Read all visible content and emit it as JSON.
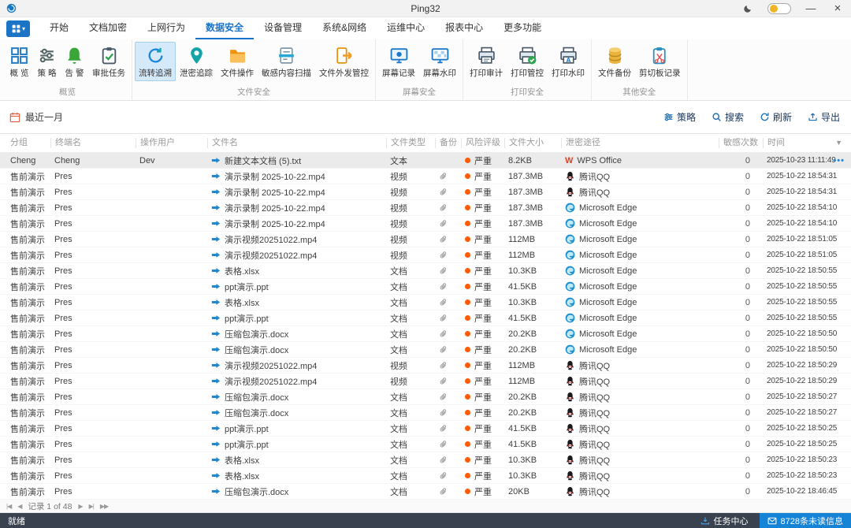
{
  "window": {
    "title": "Ping32"
  },
  "titlebar": {
    "minimize": "—",
    "close": "×"
  },
  "menu": {
    "tabs": [
      {
        "label": "开始"
      },
      {
        "label": "文档加密"
      },
      {
        "label": "上网行为"
      },
      {
        "label": "数据安全",
        "active": true
      },
      {
        "label": "设备管理"
      },
      {
        "label": "系统&网络"
      },
      {
        "label": "运维中心"
      },
      {
        "label": "报表中心"
      },
      {
        "label": "更多功能"
      }
    ]
  },
  "ribbon": {
    "groups": [
      {
        "label": "概览",
        "items": [
          {
            "label": "概 览",
            "icon": "grid"
          },
          {
            "label": "策 略",
            "icon": "sliders"
          },
          {
            "label": "告 警",
            "icon": "bell"
          },
          {
            "label": "审批任务",
            "icon": "clipboard-check"
          }
        ]
      },
      {
        "label": "文件安全",
        "items": [
          {
            "label": "流转追溯",
            "icon": "cycle",
            "selected": true
          },
          {
            "label": "泄密追踪",
            "icon": "pin"
          },
          {
            "label": "文件操作",
            "icon": "folder"
          },
          {
            "label": "敏感内容扫描",
            "icon": "doc-scan"
          },
          {
            "label": "文件外发管控",
            "icon": "doc-export"
          }
        ]
      },
      {
        "label": "屏幕安全",
        "items": [
          {
            "label": "屏幕记录",
            "icon": "monitor-record"
          },
          {
            "label": "屏幕水印",
            "icon": "monitor-watermark"
          }
        ]
      },
      {
        "label": "打印安全",
        "items": [
          {
            "label": "打印审计",
            "icon": "printer"
          },
          {
            "label": "打印管控",
            "icon": "printer-check"
          },
          {
            "label": "打印水印",
            "icon": "printer-watermark"
          }
        ]
      },
      {
        "label": "其他安全",
        "items": [
          {
            "label": "文件备份",
            "icon": "database"
          },
          {
            "label": "剪切板记录",
            "icon": "clipboard-scissors"
          }
        ]
      }
    ]
  },
  "filterbar": {
    "date_range": "最近一月",
    "actions": [
      {
        "label": "策略",
        "icon": "sliders-sm"
      },
      {
        "label": "搜索",
        "icon": "search"
      },
      {
        "label": "刷新",
        "icon": "refresh"
      },
      {
        "label": "导出",
        "icon": "export-sm"
      }
    ]
  },
  "table": {
    "columns": [
      "分组",
      "终端名",
      "操作用户",
      "文件名",
      "文件类型",
      "备份",
      "风险评级",
      "文件大小",
      "泄密途径",
      "敏感次数",
      "时间"
    ],
    "rows": [
      {
        "group": "Cheng",
        "terminal": "Cheng",
        "user": "Dev",
        "file": "新建文本文档 (5).txt",
        "type": "文本",
        "backup": false,
        "risk": "严重",
        "size": "8.2KB",
        "channel": "WPS Office",
        "channel_icon": "wps",
        "count": "0",
        "time": "2025-10-23 11:11:49",
        "selected": true
      },
      {
        "group": "售前演示",
        "terminal": "Pres",
        "user": "",
        "file": "演示录制 2025-10-22.mp4",
        "type": "视频",
        "backup": true,
        "risk": "严重",
        "size": "187.3MB",
        "channel": "腾讯QQ",
        "channel_icon": "qq",
        "count": "0",
        "time": "2025-10-22 18:54:31"
      },
      {
        "group": "售前演示",
        "terminal": "Pres",
        "user": "",
        "file": "演示录制 2025-10-22.mp4",
        "type": "视频",
        "backup": true,
        "risk": "严重",
        "size": "187.3MB",
        "channel": "腾讯QQ",
        "channel_icon": "qq",
        "count": "0",
        "time": "2025-10-22 18:54:31"
      },
      {
        "group": "售前演示",
        "terminal": "Pres",
        "user": "",
        "file": "演示录制 2025-10-22.mp4",
        "type": "视频",
        "backup": true,
        "risk": "严重",
        "size": "187.3MB",
        "channel": "Microsoft Edge",
        "channel_icon": "edge",
        "count": "0",
        "time": "2025-10-22 18:54:10"
      },
      {
        "group": "售前演示",
        "terminal": "Pres",
        "user": "",
        "file": "演示录制 2025-10-22.mp4",
        "type": "视频",
        "backup": true,
        "risk": "严重",
        "size": "187.3MB",
        "channel": "Microsoft Edge",
        "channel_icon": "edge",
        "count": "0",
        "time": "2025-10-22 18:54:10"
      },
      {
        "group": "售前演示",
        "terminal": "Pres",
        "user": "",
        "file": "演示视频20251022.mp4",
        "type": "视频",
        "backup": true,
        "risk": "严重",
        "size": "112MB",
        "channel": "Microsoft Edge",
        "channel_icon": "edge",
        "count": "0",
        "time": "2025-10-22 18:51:05"
      },
      {
        "group": "售前演示",
        "terminal": "Pres",
        "user": "",
        "file": "演示视频20251022.mp4",
        "type": "视频",
        "backup": true,
        "risk": "严重",
        "size": "112MB",
        "channel": "Microsoft Edge",
        "channel_icon": "edge",
        "count": "0",
        "time": "2025-10-22 18:51:05"
      },
      {
        "group": "售前演示",
        "terminal": "Pres",
        "user": "",
        "file": "表格.xlsx",
        "type": "文档",
        "backup": true,
        "risk": "严重",
        "size": "10.3KB",
        "channel": "Microsoft Edge",
        "channel_icon": "edge",
        "count": "0",
        "time": "2025-10-22 18:50:55"
      },
      {
        "group": "售前演示",
        "terminal": "Pres",
        "user": "",
        "file": "ppt演示.ppt",
        "type": "文档",
        "backup": true,
        "risk": "严重",
        "size": "41.5KB",
        "channel": "Microsoft Edge",
        "channel_icon": "edge",
        "count": "0",
        "time": "2025-10-22 18:50:55"
      },
      {
        "group": "售前演示",
        "terminal": "Pres",
        "user": "",
        "file": "表格.xlsx",
        "type": "文档",
        "backup": true,
        "risk": "严重",
        "size": "10.3KB",
        "channel": "Microsoft Edge",
        "channel_icon": "edge",
        "count": "0",
        "time": "2025-10-22 18:50:55"
      },
      {
        "group": "售前演示",
        "terminal": "Pres",
        "user": "",
        "file": "ppt演示.ppt",
        "type": "文档",
        "backup": true,
        "risk": "严重",
        "size": "41.5KB",
        "channel": "Microsoft Edge",
        "channel_icon": "edge",
        "count": "0",
        "time": "2025-10-22 18:50:55"
      },
      {
        "group": "售前演示",
        "terminal": "Pres",
        "user": "",
        "file": "压缩包演示.docx",
        "type": "文档",
        "backup": true,
        "risk": "严重",
        "size": "20.2KB",
        "channel": "Microsoft Edge",
        "channel_icon": "edge",
        "count": "0",
        "time": "2025-10-22 18:50:50"
      },
      {
        "group": "售前演示",
        "terminal": "Pres",
        "user": "",
        "file": "压缩包演示.docx",
        "type": "文档",
        "backup": true,
        "risk": "严重",
        "size": "20.2KB",
        "channel": "Microsoft Edge",
        "channel_icon": "edge",
        "count": "0",
        "time": "2025-10-22 18:50:50"
      },
      {
        "group": "售前演示",
        "terminal": "Pres",
        "user": "",
        "file": "演示视频20251022.mp4",
        "type": "视频",
        "backup": true,
        "risk": "严重",
        "size": "112MB",
        "channel": "腾讯QQ",
        "channel_icon": "qq",
        "count": "0",
        "time": "2025-10-22 18:50:29"
      },
      {
        "group": "售前演示",
        "terminal": "Pres",
        "user": "",
        "file": "演示视频20251022.mp4",
        "type": "视频",
        "backup": true,
        "risk": "严重",
        "size": "112MB",
        "channel": "腾讯QQ",
        "channel_icon": "qq",
        "count": "0",
        "time": "2025-10-22 18:50:29"
      },
      {
        "group": "售前演示",
        "terminal": "Pres",
        "user": "",
        "file": "压缩包演示.docx",
        "type": "文档",
        "backup": true,
        "risk": "严重",
        "size": "20.2KB",
        "channel": "腾讯QQ",
        "channel_icon": "qq",
        "count": "0",
        "time": "2025-10-22 18:50:27"
      },
      {
        "group": "售前演示",
        "terminal": "Pres",
        "user": "",
        "file": "压缩包演示.docx",
        "type": "文档",
        "backup": true,
        "risk": "严重",
        "size": "20.2KB",
        "channel": "腾讯QQ",
        "channel_icon": "qq",
        "count": "0",
        "time": "2025-10-22 18:50:27"
      },
      {
        "group": "售前演示",
        "terminal": "Pres",
        "user": "",
        "file": "ppt演示.ppt",
        "type": "文档",
        "backup": true,
        "risk": "严重",
        "size": "41.5KB",
        "channel": "腾讯QQ",
        "channel_icon": "qq",
        "count": "0",
        "time": "2025-10-22 18:50:25"
      },
      {
        "group": "售前演示",
        "terminal": "Pres",
        "user": "",
        "file": "ppt演示.ppt",
        "type": "文档",
        "backup": true,
        "risk": "严重",
        "size": "41.5KB",
        "channel": "腾讯QQ",
        "channel_icon": "qq",
        "count": "0",
        "time": "2025-10-22 18:50:25"
      },
      {
        "group": "售前演示",
        "terminal": "Pres",
        "user": "",
        "file": "表格.xlsx",
        "type": "文档",
        "backup": true,
        "risk": "严重",
        "size": "10.3KB",
        "channel": "腾讯QQ",
        "channel_icon": "qq",
        "count": "0",
        "time": "2025-10-22 18:50:23"
      },
      {
        "group": "售前演示",
        "terminal": "Pres",
        "user": "",
        "file": "表格.xlsx",
        "type": "文档",
        "backup": true,
        "risk": "严重",
        "size": "10.3KB",
        "channel": "腾讯QQ",
        "channel_icon": "qq",
        "count": "0",
        "time": "2025-10-22 18:50:23"
      },
      {
        "group": "售前演示",
        "terminal": "Pres",
        "user": "",
        "file": "压缩包演示.docx",
        "type": "文档",
        "backup": true,
        "risk": "严重",
        "size": "20KB",
        "channel": "腾讯QQ",
        "channel_icon": "qq",
        "count": "0",
        "time": "2025-10-22 18:46:45"
      }
    ]
  },
  "pagination": {
    "record_label": "记录 1 of 48"
  },
  "statusbar": {
    "ready": "就绪",
    "task_center": "任务中心",
    "unread": "8728条未读信息"
  },
  "colors": {
    "accent": "#1a73c9",
    "risk_severe": "#ff5a00",
    "status_bar": "#39424e",
    "unread_badge": "#1583d6"
  }
}
